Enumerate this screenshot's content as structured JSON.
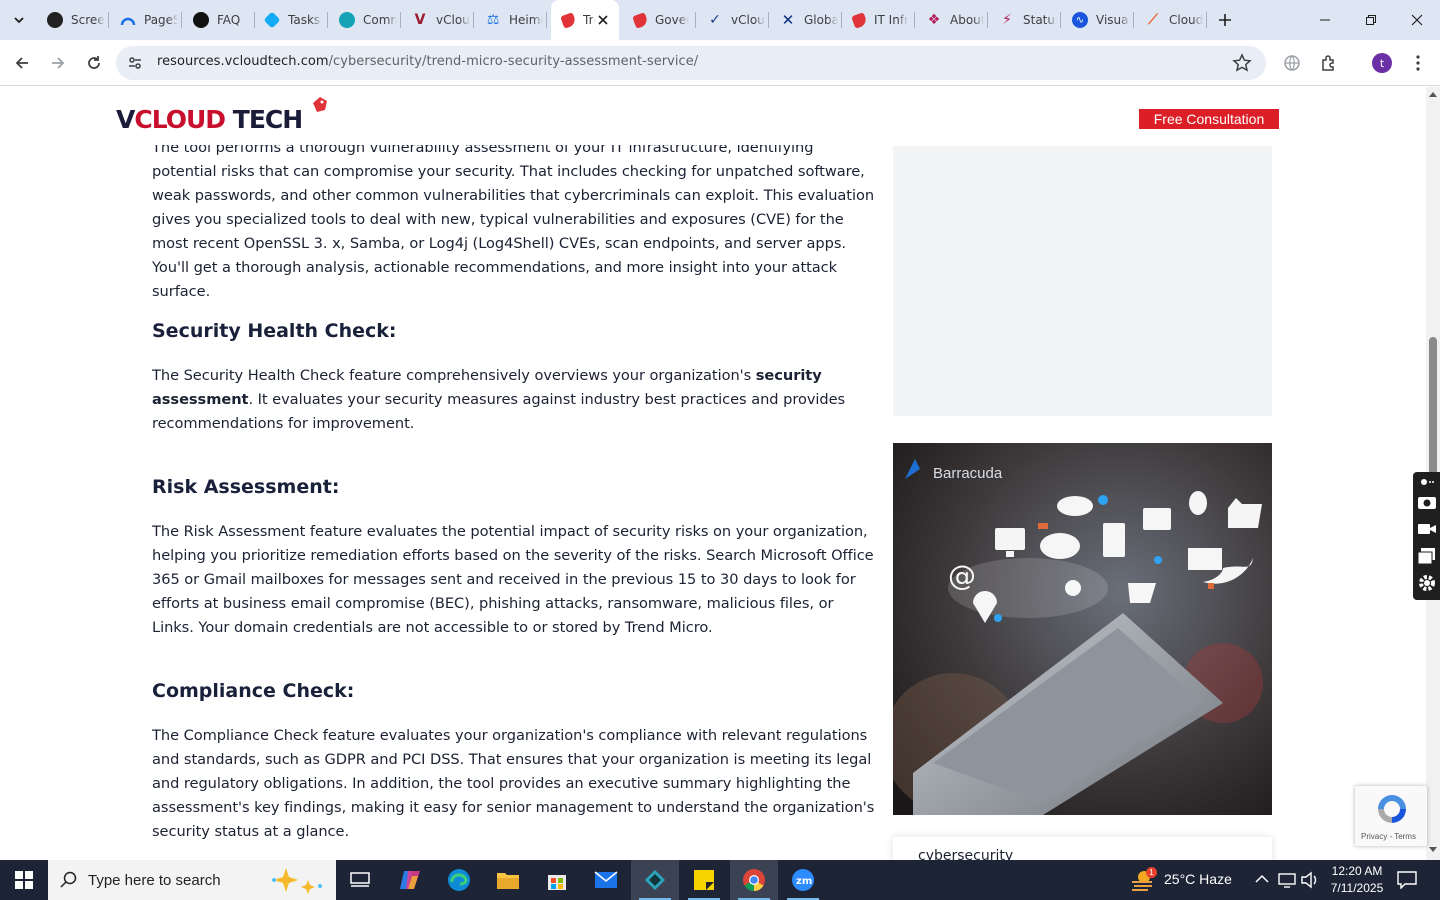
{
  "browser": {
    "tabs": [
      {
        "title": "Screencastify"
      },
      {
        "title": "PageSpeed"
      },
      {
        "title": "FAQ"
      },
      {
        "title": "Tasks"
      },
      {
        "title": "Community"
      },
      {
        "title": "vCloud"
      },
      {
        "title": "Heimdal"
      },
      {
        "title": "Trend Micro"
      },
      {
        "title": "Governance"
      },
      {
        "title": "vCloud"
      },
      {
        "title": "Global"
      },
      {
        "title": "IT Infrastructure"
      },
      {
        "title": "About"
      },
      {
        "title": "Status"
      },
      {
        "title": "Visual"
      },
      {
        "title": "Cloud"
      }
    ],
    "url_host": "resources.vcloudtech.com",
    "url_path": "/cybersecurity/trend-micro-security-assessment-service/",
    "profile_initial": "t"
  },
  "site": {
    "logo_v": "V",
    "logo_cloud": "CLOUD",
    "logo_tech": " TECH",
    "cta": "Free Consultation"
  },
  "article": {
    "intro": "The tool performs a thorough vulnerability assessment of your IT infrastructure, identifying potential risks that can compromise your security. That includes checking for unpatched software, weak passwords, and other common vulnerabilities that cybercriminals can exploit. This evaluation gives you specialized tools to deal with new, typical vulnerabilities and exposures (CVE) for the most recent OpenSSL 3. x, Samba, or Log4j (Log4Shell) CVEs, scan endpoints, and server apps. You'll get a thorough analysis, actionable recommendations, and more insight into your attack surface.",
    "health_heading": "Security Health Check:",
    "health_p1": "The Security Health Check feature comprehensively overviews your organization's ",
    "health_bold": "security assessment",
    "health_p2": ". It evaluates your security measures against industry best practices and provides recommendations for improvement.",
    "risk_heading": "Risk Assessment:",
    "risk_text": "The Risk Assessment feature evaluates the potential impact of security risks on your organization, helping you prioritize remediation efforts based on the severity of the risks. Search Microsoft Office 365 or Gmail mailboxes for messages sent and received in the previous 15 to 30 days to look for efforts at business email compromise (BEC), phishing attacks, ransomware, malicious files, or Links. Your domain credentials are not accessible to or stored by Trend Micro.",
    "compliance_heading": "Compliance Check:",
    "compliance_text": "The Compliance Check feature evaluates your organization's compliance with relevant regulations and standards, such as GDPR and PCI DSS. That ensures that your organization is meeting its legal and regulatory obligations. In addition, the tool provides an executive summary highlighting the assessment's key findings, making it easy for senior management to understand the organization's security status at a glance."
  },
  "sidebar": {
    "banner_brand": "Barracuda",
    "category_label": "cybersecurity"
  },
  "recaptcha": {
    "label": "Privacy - Terms"
  },
  "taskbar": {
    "search_placeholder": "Type here to search",
    "weather": "25°C  Haze",
    "weather_badge": "1",
    "time": "12:20 AM",
    "date": "7/11/2025"
  },
  "colors": {
    "accent_red": "#dc1f26",
    "heading": "#19203a",
    "taskbar": "#1c2436"
  }
}
